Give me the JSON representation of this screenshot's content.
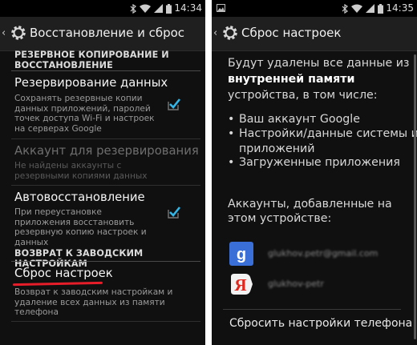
{
  "left_screen": {
    "status_bar": {
      "time": "14:34",
      "icons": [
        "bluetooth-icon",
        "wifi-icon",
        "signal-icon",
        "battery-icon"
      ]
    },
    "action_bar": {
      "title": "Восстановление и сброс",
      "icon": "gear-icon"
    },
    "backup_section": {
      "header_line1": "РЕЗЕРВНОЕ КОПИРОВАНИЕ И",
      "header_line2": "ВОССТАНОВЛЕНИЕ",
      "items": [
        {
          "title": "Резервирование данных",
          "summary": "Сохранять резервные копии данных приложений, паролей точек доступа Wi-Fi и настроек на серверах Google",
          "checked": true,
          "enabled": true
        },
        {
          "title": "Аккаунт для резервирования",
          "summary": "Не найдены аккаунты с резервными копиями данных",
          "enabled": false
        },
        {
          "title": "Автовосстановление",
          "summary": "При переустановке приложения восстановить резервную копию настроек и данных",
          "checked": true,
          "enabled": true
        }
      ]
    },
    "factory_section": {
      "header": "ВОЗВРАТ К ЗАВОДСКИМ НАСТРОЙКАМ",
      "item": {
        "title": "Сброс настроек",
        "summary": "Возврат к заводским настройкам и удаление всех данных из памяти телефона"
      }
    },
    "colors": {
      "checkbox": "#33b5e5",
      "highlight_underline": "#e81d2a"
    }
  },
  "right_screen": {
    "status_bar": {
      "time": "14:35",
      "left_icon": "image-notification-icon",
      "icons": [
        "bluetooth-icon",
        "wifi-icon",
        "signal-icon",
        "battery-icon"
      ]
    },
    "action_bar": {
      "title": "Сброс настроек",
      "icon": "gear-icon"
    },
    "intro_line1": "Будут удалены все данные из",
    "intro_bold": "внутренней памяти",
    "intro_line3": "устройства, в том числе:",
    "bullets": [
      {
        "line1": "Ваш аккаунт Google",
        "line2": ""
      },
      {
        "line1": "Настройки/данные системы и",
        "line2": "приложений"
      },
      {
        "line1": "Загруженные приложения",
        "line2": ""
      }
    ],
    "accounts_label_line1": "Аккаунты, добавленные на",
    "accounts_label_line2": "этом устройстве:",
    "accounts": [
      {
        "icon": "google-account-icon",
        "name": "glukhov.petr@gmail.com"
      },
      {
        "icon": "yandex-account-icon",
        "name": "glukhov-petr"
      }
    ],
    "reset_button": "Сбросить настройки телефона"
  }
}
